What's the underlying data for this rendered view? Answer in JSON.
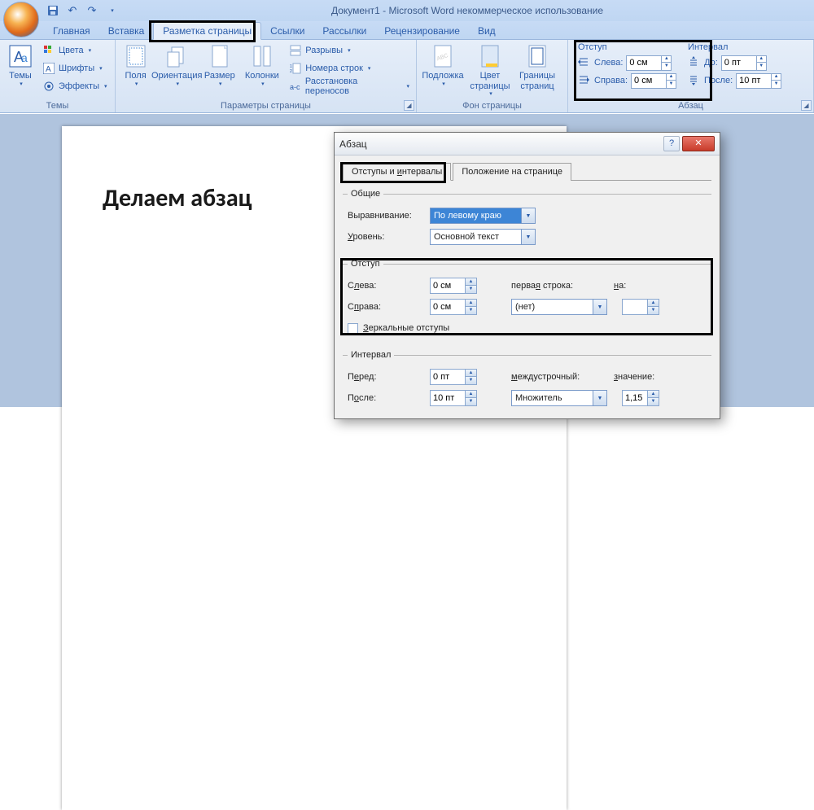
{
  "title": "Документ1 - Microsoft Word некоммерческое использование",
  "tabs": [
    "Главная",
    "Вставка",
    "Разметка страницы",
    "Ссылки",
    "Рассылки",
    "Рецензирование",
    "Вид"
  ],
  "active_tab": 2,
  "groups": {
    "themes": {
      "label": "Темы",
      "big": "Темы",
      "colors": "Цвета",
      "fonts": "Шрифты",
      "effects": "Эффекты"
    },
    "page_setup": {
      "label": "Параметры страницы",
      "margins": "Поля",
      "orientation": "Ориентация",
      "size": "Размер",
      "columns": "Колонки",
      "breaks": "Разрывы",
      "line_numbers": "Номера строк",
      "hyphenation": "Расстановка переносов"
    },
    "page_bg": {
      "label": "Фон страницы",
      "watermark": "Подложка",
      "page_color": "Цвет страницы",
      "page_borders": "Границы страниц"
    },
    "paragraph": {
      "label": "Абзац",
      "indent_hdr": "Отступ",
      "spacing_hdr": "Интервал",
      "left": "Слева:",
      "right": "Справа:",
      "before": "До:",
      "after": "После:",
      "left_val": "0 см",
      "right_val": "0 см",
      "before_val": "0 пт",
      "after_val": "10 пт"
    }
  },
  "doc_heading": "Делаем абзац",
  "dialog": {
    "title": "Абзац",
    "tab1": "Отступы и интервалы",
    "tab2": "Положение на странице",
    "general": "Общие",
    "alignment": "Выравнивание:",
    "alignment_val": "По левому краю",
    "level": "Уровень:",
    "level_val": "Основной текст",
    "indent": "Отступ",
    "left_u": "Слева:",
    "right_u": "Справа:",
    "first_line": "первая строка:",
    "on": "на:",
    "left_val": "0 см",
    "right_val": "0 см",
    "first_val": "(нет)",
    "mirror": "Зеркальные отступы",
    "spacing": "Интервал",
    "before_u": "Перед:",
    "after_u": "После:",
    "line_spacing": "междустрочный:",
    "value": "значение:",
    "before_val": "0 пт",
    "after_val": "10 пт",
    "ls_val": "Множитель",
    "val_val": "1,15"
  }
}
